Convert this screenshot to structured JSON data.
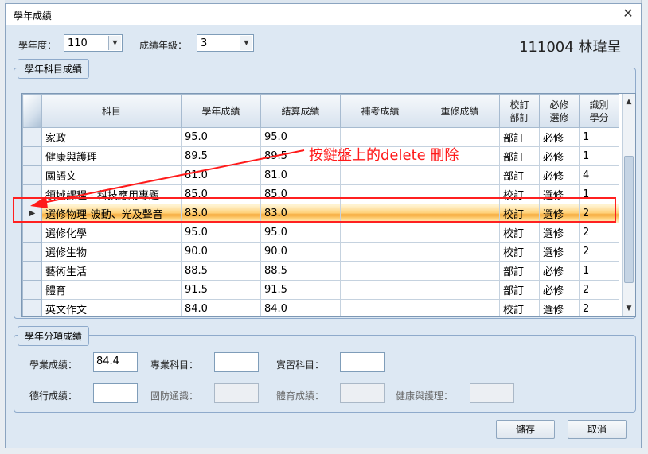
{
  "window": {
    "title": "學年成績",
    "close_glyph": "✕"
  },
  "filters": {
    "year_label": "學年度：",
    "year_value": "110",
    "grade_label": "成績年級：",
    "grade_value": "3",
    "student": "111004  林瑋呈"
  },
  "subjects_group": {
    "title": "學年科目成績",
    "columns": [
      "科目",
      "學年成績",
      "結算成績",
      "補考成績",
      "重修成績",
      "校訂\n部訂",
      "必修\n選修",
      "識別\n學分"
    ],
    "rows": [
      [
        "家政",
        "95.0",
        "95.0",
        "",
        "",
        "部訂",
        "必修",
        "1"
      ],
      [
        "健康與護理",
        "89.5",
        "89.5",
        "",
        "",
        "部訂",
        "必修",
        "1"
      ],
      [
        "國語文",
        "81.0",
        "81.0",
        "",
        "",
        "部訂",
        "必修",
        "4"
      ],
      [
        "領域課程 - 科技應用專題",
        "85.0",
        "85.0",
        "",
        "",
        "校訂",
        "選修",
        "1"
      ],
      [
        "選修物理-波動、光及聲音",
        "83.0",
        "83.0",
        "",
        "",
        "校訂",
        "選修",
        "2"
      ],
      [
        "選修化學",
        "95.0",
        "95.0",
        "",
        "",
        "校訂",
        "選修",
        "2"
      ],
      [
        "選修生物",
        "90.0",
        "90.0",
        "",
        "",
        "校訂",
        "選修",
        "2"
      ],
      [
        "藝術生活",
        "88.5",
        "88.5",
        "",
        "",
        "部訂",
        "必修",
        "1"
      ],
      [
        "體育",
        "91.5",
        "91.5",
        "",
        "",
        "部訂",
        "必修",
        "2"
      ],
      [
        "英文作文",
        "84.0",
        "84.0",
        "",
        "",
        "校訂",
        "選修",
        "2"
      ]
    ],
    "selected_row": 4,
    "row_pointer": "▶"
  },
  "annotation": {
    "text": "按鍵盤上的delete 刪除",
    "color": "#ff1a1a"
  },
  "category_group": {
    "title": "學年分項成績",
    "fields": [
      {
        "label": "學業成績：",
        "value": "84.4",
        "enabled": true
      },
      {
        "label": "專業科目：",
        "value": "",
        "enabled": true
      },
      {
        "label": "實習科目：",
        "value": "",
        "enabled": true
      },
      {
        "label": "德行成績：",
        "value": "",
        "enabled": true
      },
      {
        "label": "國防通識：",
        "value": "",
        "enabled": false
      },
      {
        "label": "體育成績：",
        "value": "",
        "enabled": false
      },
      {
        "label": "健康與護理：",
        "value": "",
        "enabled": false
      }
    ]
  },
  "buttons": {
    "save": "儲存",
    "cancel": "取消"
  }
}
